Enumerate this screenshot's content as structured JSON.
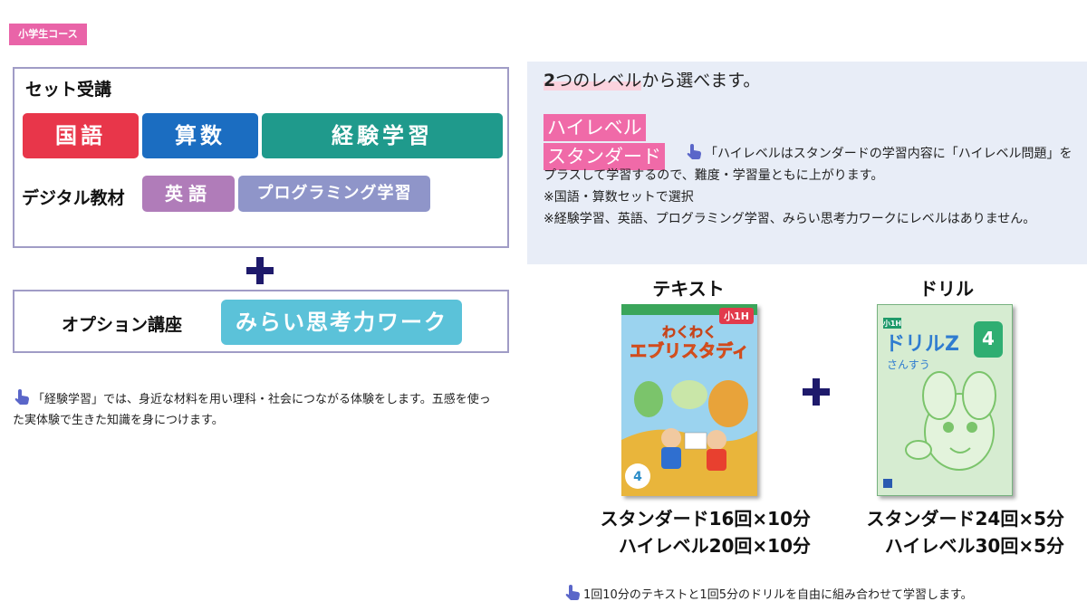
{
  "course_badge": "小学生コース",
  "set_course": {
    "title": "セット受講",
    "subjects": [
      "国語",
      "算数",
      "経験学習"
    ],
    "digital_label": "デジタル教材",
    "digital_subjects": [
      "英語",
      "プログラミング学習"
    ]
  },
  "option": {
    "label": "オプション講座",
    "button": "みらい思考力ワーク"
  },
  "left_note": "「経験学習」では、身近な材料を用い理科・社会につながる体験をします。五感を使った実体験で生きた知識を身につけます。",
  "levels": {
    "heading_num": "2",
    "heading_rest": "つのレベル",
    "heading_tail": "から選べます。",
    "high": "ハイレベル",
    "standard": "スタンダード",
    "description": "「ハイレベルはスタンダードの学習内容に「ハイレベル問題」をプラスして学習するので、難度・学習量ともに上がります。",
    "note1": "※国語・算数セットで選択",
    "note2": "※経験学習、英語、プログラミング学習、みらい思考力ワークにレベルはありません。"
  },
  "text_book": {
    "title": "テキスト",
    "cover_title_top": "わくわく",
    "cover_title": "エブリスタディ",
    "grade": "小1H",
    "month": "4",
    "standard": "スタンダード16回×10分",
    "high": "ハイレベル20回×10分"
  },
  "drill_book": {
    "title": "ドリル",
    "cover_title": "ドリルZ",
    "cover_sub": "さんすう",
    "grade": "小1H",
    "month": "4",
    "standard": "スタンダード24回×5分",
    "high": "ハイレベル30回×5分"
  },
  "bottom_note": "1回10分のテキストと1回5分のドリルを自由に組み合わせて学習します。",
  "colors": {
    "kokugo": "#e8364a",
    "sansu": "#1b6dc1",
    "keiken": "#1f9a8c",
    "eigo": "#b07cb9",
    "programming": "#8f95c9",
    "option": "#5bc2d9",
    "pink": "#f06aa8",
    "plus": "#1e1a6b"
  },
  "icons": [
    "pointing-hand-icon",
    "plus-icon"
  ]
}
